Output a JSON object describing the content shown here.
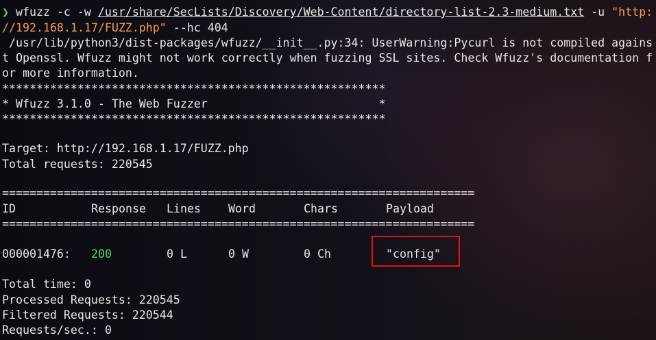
{
  "command": {
    "prompt_symbol": "❯",
    "program": "wfuzz",
    "flags_before_path": " -c -w ",
    "wordlist_path": "/usr/share/SecLists/Discovery/Web-Content/directory-list-2.3-medium.txt",
    "url_flag": " -u ",
    "url_part1": "\"http:",
    "url_part2": "//192.168.1.17/FUZZ.php\"",
    "hide_code": " --hc 404"
  },
  "warning": {
    "line1": " /usr/lib/python3/dist-packages/wfuzz/__init__.py:34: UserWarning:Pycurl is not compiled agains",
    "line2": "t Openssl. Wfuzz might not work correctly when fuzzing SSL sites. Check Wfuzz's documentation f",
    "line3": "or more information."
  },
  "banner": {
    "stars": "********************************************************",
    "title": "* Wfuzz 3.1.0 - The Web Fuzzer                         *"
  },
  "target": {
    "target_line": "Target: http://192.168.1.17/FUZZ.php",
    "total_requests_line": "Total requests: 220545"
  },
  "table": {
    "separator": "=====================================================================",
    "headers": {
      "id": "ID",
      "response": "Response",
      "lines": "Lines",
      "word": "Word",
      "chars": "Chars",
      "payload": "Payload"
    },
    "rows": [
      {
        "id": "000001476:",
        "response": "200",
        "lines": "0 L",
        "word": "0 W",
        "chars": "0 Ch",
        "payload": "\"config\""
      }
    ]
  },
  "summary": {
    "total_time": "Total time: 0",
    "processed": "Processed Requests: 220545",
    "filtered": "Filtered Requests: 220544",
    "rate": "Requests/sec.: 0"
  },
  "colors": {
    "prompt_green": "#4cd96b",
    "url_orange": "#f0a050",
    "highlight_red": "#e01414",
    "text": "#e8e8e8"
  }
}
